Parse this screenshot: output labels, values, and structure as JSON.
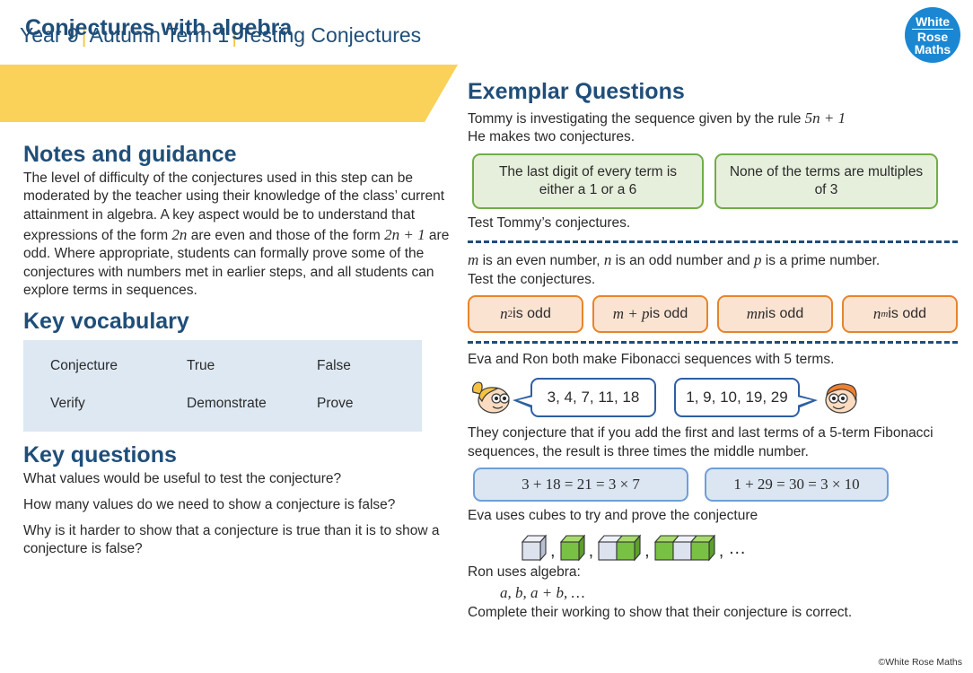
{
  "header": {
    "year": "Year 9",
    "term": "Autumn Term 1",
    "topic": "Testing Conjectures",
    "separator": "|",
    "logo": {
      "line1": "White",
      "line2": "Rose",
      "line3": "Maths"
    }
  },
  "banner": {
    "title": "Conjectures with algebra"
  },
  "left": {
    "notes_heading": "Notes and guidance",
    "notes_body_1": "The level of difficulty of the conjectures used in this step can be moderated by the teacher using their knowledge of the class’ current attainment in algebra. A key aspect would be to understand that expressions of the form ",
    "notes_math_1": "2n",
    "notes_body_2": " are even and those of the form ",
    "notes_math_2": "2n + 1",
    "notes_body_3": " are odd. Where appropriate, students can formally prove some of the conjectures with numbers met in earlier steps, and all students can explore terms in sequences.",
    "vocab_heading": "Key vocabulary",
    "vocab_rows": [
      [
        "Conjecture",
        "True",
        "False"
      ],
      [
        "Verify",
        "Demonstrate",
        "Prove"
      ]
    ],
    "questions_heading": "Key questions",
    "questions": [
      "What values would be useful to test the conjecture?",
      "How many values do we need to show a conjecture is false?",
      "Why is it harder to show that a conjecture is true than it is to show a conjecture is false?"
    ]
  },
  "right": {
    "heading": "Exemplar Questions",
    "intro_1": "Tommy is investigating the sequence given by the rule ",
    "intro_rule": "5n + 1",
    "intro_2": "He makes two conjectures.",
    "green_boxes": [
      "The last digit of every term is either a 1 or a 6",
      "None of the terms are multiples of 3"
    ],
    "test_tommy": "Test Tommy’s conjectures.",
    "mnp_line_a": "m",
    "mnp_line_b": " is an even number, ",
    "mnp_line_c": "n",
    "mnp_line_d": " is an odd number and ",
    "mnp_line_e": "p",
    "mnp_line_f": " is a prime number.",
    "test_conjectures": "Test the conjectures.",
    "orange_boxes": [
      {
        "expr": "n",
        "sup": "2",
        "tail": " is odd"
      },
      {
        "expr": "m + p",
        "sup": "",
        "tail": " is odd"
      },
      {
        "expr": "mn",
        "sup": "",
        "tail": " is odd"
      },
      {
        "expr": "n",
        "sup": "m",
        "tail": " is odd"
      }
    ],
    "fib_intro": "Eva and Ron both make Fibonacci sequences with 5 terms.",
    "eva_sequence": "3, 4, 7, 11, 18",
    "ron_sequence": "1, 9, 10, 19, 29",
    "fib_conjecture": "They conjecture that if you add the first and last terms of a 5-term Fibonacci sequences, the result is three times the middle number.",
    "blue_boxes": [
      "3 + 18 = 21 = 3 × 7",
      "1 + 29 = 30 = 3 × 10"
    ],
    "eva_cubes_line": "Eva uses cubes to try and prove the conjecture",
    "cube_groups": [
      [
        "white"
      ],
      [
        "green"
      ],
      [
        "white",
        "green"
      ],
      [
        "green",
        "white",
        "green"
      ]
    ],
    "cubes_ellipsis": "…",
    "comma": ",",
    "ron_algebra_line": "Ron uses algebra:",
    "ron_algebra": "a, b, a + b, …",
    "closing": "Complete their working to show that their conjecture is correct."
  },
  "footer": {
    "copyright": "©White Rose Maths"
  },
  "colors": {
    "navy": "#1f4e79",
    "yellow": "#fad159",
    "green_border": "#70ad47",
    "green_fill": "#e6efdc",
    "orange_border": "#e8842a",
    "orange_fill": "#fbe3d2",
    "blue_border": "#6f9fd8",
    "blue_fill": "#dbe6f2",
    "vocab_fill": "#dde8f3",
    "logo_blue": "#1b87d2",
    "cube_green": "#79c143",
    "cube_white": "#dde3ee"
  }
}
